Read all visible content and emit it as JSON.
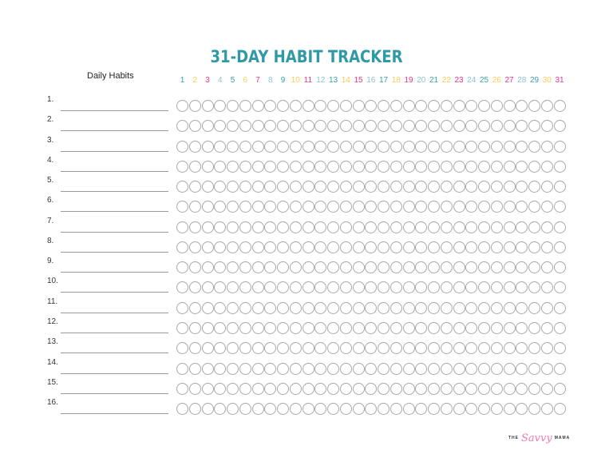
{
  "title": "31-DAY HABIT TRACKER",
  "habits_header": "Daily Habits",
  "colors": {
    "teal": "#3a9fab",
    "yellow": "#f9cc54",
    "pink": "#e8358f",
    "light_teal": "#8ec3cb",
    "title": "#2f9aa5",
    "circle_border": "#a8a8a8",
    "line": "#9a9a9a"
  },
  "days": [
    {
      "label": "1",
      "color": "teal"
    },
    {
      "label": "2",
      "color": "yellow"
    },
    {
      "label": "3",
      "color": "pink"
    },
    {
      "label": "4",
      "color": "light_teal"
    },
    {
      "label": "5",
      "color": "teal"
    },
    {
      "label": "6",
      "color": "yellow"
    },
    {
      "label": "7",
      "color": "pink"
    },
    {
      "label": "8",
      "color": "light_teal"
    },
    {
      "label": "9",
      "color": "teal"
    },
    {
      "label": "10",
      "color": "yellow"
    },
    {
      "label": "11",
      "color": "pink"
    },
    {
      "label": "12",
      "color": "light_teal"
    },
    {
      "label": "13",
      "color": "teal"
    },
    {
      "label": "14",
      "color": "yellow"
    },
    {
      "label": "15",
      "color": "pink"
    },
    {
      "label": "16",
      "color": "light_teal"
    },
    {
      "label": "17",
      "color": "teal"
    },
    {
      "label": "18",
      "color": "yellow"
    },
    {
      "label": "19",
      "color": "pink"
    },
    {
      "label": "20",
      "color": "light_teal"
    },
    {
      "label": "21",
      "color": "teal"
    },
    {
      "label": "22",
      "color": "yellow"
    },
    {
      "label": "23",
      "color": "pink"
    },
    {
      "label": "24",
      "color": "light_teal"
    },
    {
      "label": "25",
      "color": "teal"
    },
    {
      "label": "26",
      "color": "yellow"
    },
    {
      "label": "27",
      "color": "pink"
    },
    {
      "label": "28",
      "color": "light_teal"
    },
    {
      "label": "29",
      "color": "teal"
    },
    {
      "label": "30",
      "color": "yellow"
    },
    {
      "label": "31",
      "color": "pink"
    }
  ],
  "habits": [
    {
      "number": "1.",
      "name": ""
    },
    {
      "number": "2.",
      "name": ""
    },
    {
      "number": "3.",
      "name": ""
    },
    {
      "number": "4.",
      "name": ""
    },
    {
      "number": "5.",
      "name": ""
    },
    {
      "number": "6.",
      "name": ""
    },
    {
      "number": "7.",
      "name": ""
    },
    {
      "number": "8.",
      "name": ""
    },
    {
      "number": "9.",
      "name": ""
    },
    {
      "number": "10.",
      "name": ""
    },
    {
      "number": "11.",
      "name": ""
    },
    {
      "number": "12.",
      "name": ""
    },
    {
      "number": "13.",
      "name": ""
    },
    {
      "number": "14.",
      "name": ""
    },
    {
      "number": "15.",
      "name": ""
    },
    {
      "number": "16.",
      "name": ""
    }
  ],
  "brand": {
    "prefix": "THE",
    "script": "Savvy",
    "suffix": "MAMA"
  }
}
